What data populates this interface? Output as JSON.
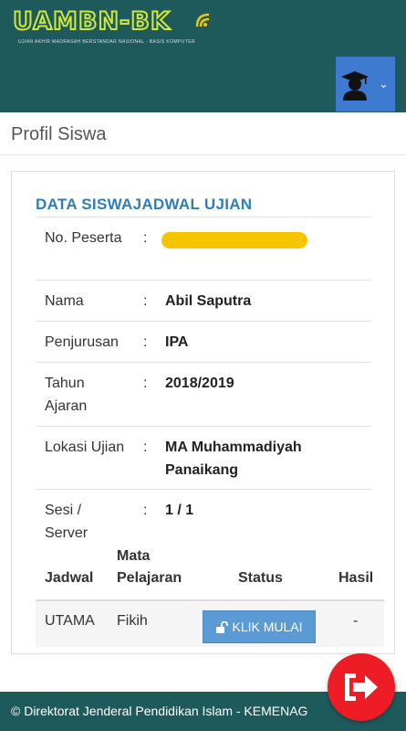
{
  "header": {
    "logo_text": "UAMBN-BK",
    "logo_subtitle": "UJIAN AKHIR MADRASAH BERSTANDAR NASIONAL - BASIS KOMPUTER",
    "user_menu_icon": "graduate-avatar-icon",
    "dropdown_icon": "chevron-down-icon"
  },
  "page": {
    "title": "Profil Siswa"
  },
  "card": {
    "heading_data": "DATA SISWA",
    "heading_schedule": "JADWAL UJIAN",
    "fields": [
      {
        "label": "No. Peserta",
        "value": ""
      },
      {
        "label": "Nama",
        "value": "Abil Saputra"
      },
      {
        "label": "Penjurusan",
        "value": "IPA"
      },
      {
        "label": "Tahun Ajaran",
        "value": "2018/2019"
      },
      {
        "label": "Lokasi Ujian",
        "value": "MA Muhammadiyah Panaikang"
      },
      {
        "label": "Sesi / Server",
        "value": "1 / 1"
      }
    ],
    "colon": ":",
    "masked_color": "#f7c500"
  },
  "schedule": {
    "headers": [
      "Jadwal",
      "Mata Pelajaran",
      "Status",
      "Hasil"
    ],
    "rows": [
      {
        "jadwal": "UTAMA",
        "mapel": "Fikih",
        "status_button": "KLIK MULAI",
        "hasil": "-"
      }
    ]
  },
  "footer": {
    "text": "© Direktorat Jenderal Pendidikan Islam - KEMENAG"
  },
  "fab": {
    "icon": "logout-icon",
    "color": "#ee1c24"
  },
  "colors": {
    "header": "#1e5a5c",
    "accent": "#2f7eb5",
    "button": "#5b9bd5"
  }
}
